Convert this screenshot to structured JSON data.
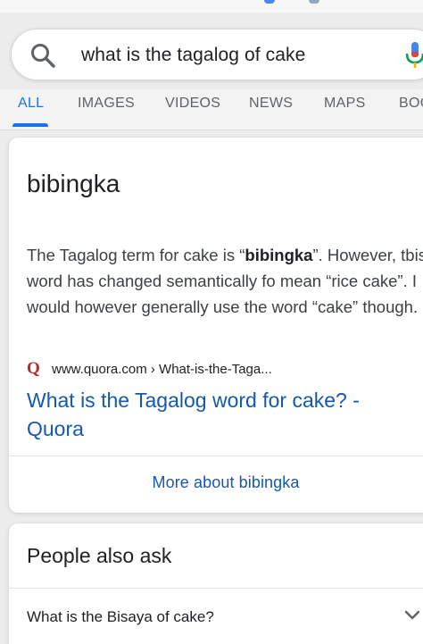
{
  "search": {
    "query": "what is the tagalog of cake",
    "icon": "search-icon",
    "mic_icon": "mic-icon"
  },
  "tabs": [
    {
      "label": "ALL",
      "active": true
    },
    {
      "label": "IMAGES"
    },
    {
      "label": "VIDEOS"
    },
    {
      "label": "NEWS"
    },
    {
      "label": "MAPS"
    },
    {
      "label": "BOO"
    }
  ],
  "answer": {
    "title": "bibingka",
    "snippet_before": "The Tagalog term for cake is “",
    "snippet_bold": "bibingka",
    "snippet_after": "”. However, tbis word has changed semantically fo mean “rice cake”. I would however generally use the word “cake” though.",
    "source_logo": "Q",
    "source_url": "www.quora.com › What-is-the-Taga...",
    "result_title": "What is the Tagalog word for cake? - Quora",
    "more_link": "More about bibingka"
  },
  "people_also_ask": {
    "title": "People also ask",
    "questions": [
      "What is the Bisaya of cake?"
    ]
  },
  "colors": {
    "accent": "#1a73e8",
    "link": "#1558b0",
    "quora": "#b92b27"
  }
}
